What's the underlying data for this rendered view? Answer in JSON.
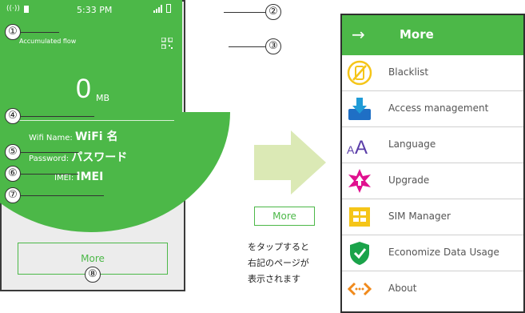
{
  "phone": {
    "status_time": "5:33 PM",
    "accumulated_label": "Accumulated flow",
    "flow_value": "0",
    "flow_unit": "MB",
    "wifi_label": "Wifi Name:",
    "wifi_value": "WiFi 名",
    "password_label": "Password:",
    "password_value": "パスワード",
    "imei_label": "IMEI:",
    "imei_value": "IMEI",
    "more_button": "More"
  },
  "callouts": [
    "①",
    "②",
    "③",
    "④",
    "⑤",
    "⑥",
    "⑦",
    "⑧"
  ],
  "middle": {
    "more_box": "More",
    "desc_lines": [
      "をタップすると",
      "右記のページが",
      "表示されます"
    ]
  },
  "panel": {
    "title": "More",
    "items": [
      {
        "label": "Blacklist",
        "icon": "blacklist-icon"
      },
      {
        "label": "Access management",
        "icon": "download-icon"
      },
      {
        "label": "Language",
        "icon": "language-icon"
      },
      {
        "label": "Upgrade",
        "icon": "upgrade-icon"
      },
      {
        "label": "SIM Manager",
        "icon": "sim-icon"
      },
      {
        "label": "Economize Data Usage",
        "icon": "shield-check-icon"
      },
      {
        "label": "About",
        "icon": "code-icon"
      }
    ]
  },
  "colors": {
    "green": "#4cb848",
    "light_green": "#dbe9b5"
  }
}
